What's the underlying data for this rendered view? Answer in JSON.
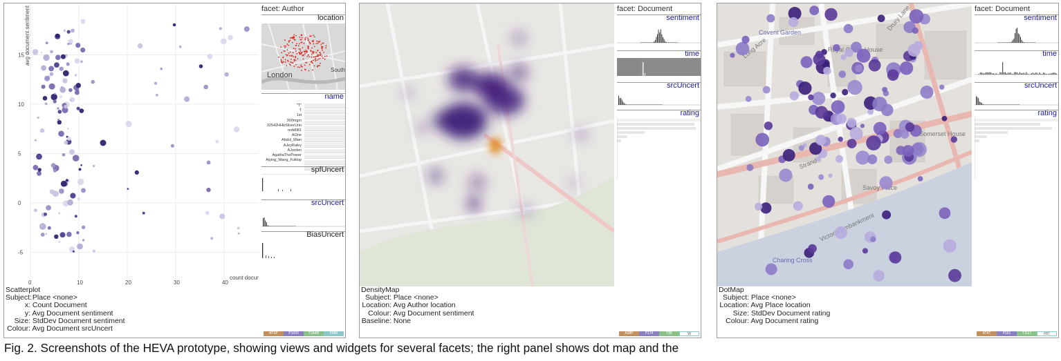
{
  "panels": [
    {
      "facet": "facet: Author",
      "widgets": [
        "location",
        "name",
        "spfUncert",
        "srcUncert",
        "BiasUncert"
      ],
      "map_labels": [
        "London",
        "South"
      ],
      "names": [
        "\"T\"",
        "T",
        "1st",
        "300mgm",
        "32542HHbSilverUrin",
        "redd081",
        "AOne",
        "Abdul_Mian",
        "AJeyRaley",
        "AJorden",
        "AgathaThePower",
        "Aiying_Wang_Fulitop"
      ],
      "x_ticks": [
        "0",
        "10",
        "20",
        "30",
        "40"
      ],
      "y_ticks": [
        "15",
        "10",
        "5",
        "0",
        "-5"
      ],
      "x_label": "count document",
      "y_label": "avg document sentiment",
      "info_title": "Scatterplot",
      "info": [
        {
          "k": "Subject:",
          "v": "Place <none>"
        },
        {
          "k": "x:",
          "v": "Count Document"
        },
        {
          "k": "y:",
          "v": "Avg Document sentiment"
        },
        {
          "k": "Size:",
          "v": "StdDev Document sentiment"
        },
        {
          "k": "Colour:",
          "v": "Avg Document srcUncert"
        }
      ],
      "legend": [
        "ATSP",
        "P1000",
        "T1AAB",
        "F888"
      ]
    },
    {
      "facet": "facet: Document",
      "widgets": [
        "sentiment",
        "time",
        "srcUncert",
        "rating"
      ],
      "info_title": "DensityMap",
      "info": [
        {
          "k": "Subject:",
          "v": "Place <none>"
        },
        {
          "k": "Location:",
          "v": "Avg Author location"
        },
        {
          "k": "Colour:",
          "v": "Avg Document sentiment"
        },
        {
          "k": "Baseline:",
          "v": "None"
        }
      ],
      "legend": [
        "A38P",
        "P174",
        "T88",
        "W"
      ]
    },
    {
      "facet": "facet: Document",
      "widgets": [
        "sentiment",
        "time",
        "srcUncert",
        "rating"
      ],
      "map_labels": [
        "Covent Garden",
        "Royal Opera House",
        "Somerset House",
        "Strand",
        "Savoy Place",
        "Victoria Embankment",
        "Long Acre",
        "Drury Lane",
        "Charing Cross"
      ],
      "info_title": "DotMap",
      "info": [
        {
          "k": "Subject:",
          "v": "Place <none>"
        },
        {
          "k": "Location:",
          "v": "Avg Place location"
        },
        {
          "k": "Size:",
          "v": "StdDev Document rating"
        },
        {
          "k": "Colour:",
          "v": "Avg Document rating"
        }
      ],
      "legend": [
        "AT47",
        "P161",
        "T1117",
        "F87"
      ]
    }
  ],
  "caption": "Fig. 2. Screenshots of the HEVA prototype, showing views and widgets for several facets; the right panel shows dot map and the"
}
